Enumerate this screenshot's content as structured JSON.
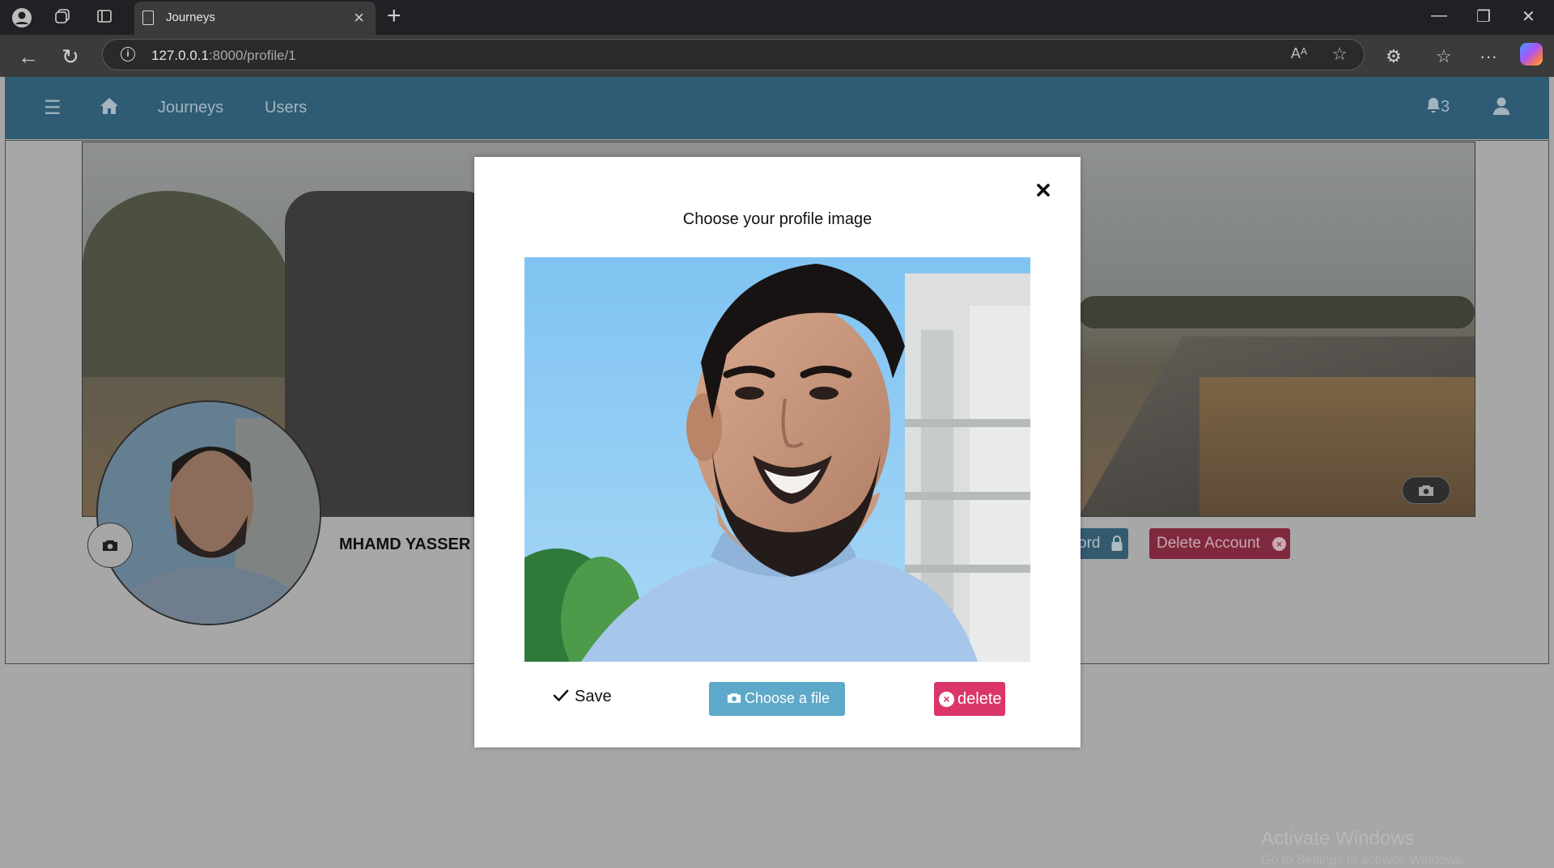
{
  "browser": {
    "tab_title": "Journeys",
    "url_host": "127.0.0.1",
    "url_rest": ":8000/profile/1"
  },
  "nav": {
    "links": [
      "Journeys",
      "Users"
    ],
    "notification_count": "3"
  },
  "profile": {
    "name": "MHAMD YASSER",
    "change_password_partial": "ord",
    "delete_account_label": "Delete Account"
  },
  "modal": {
    "title": "Choose your profile image",
    "save_label": "Save",
    "choose_label": "Choose a file",
    "delete_label": "delete"
  },
  "watermark": {
    "line1": "Activate Windows",
    "line2": "Go to Settings to activate Windows."
  },
  "colors": {
    "navbar": "#2f5c74",
    "choose_button": "#5ea9c9",
    "delete_button": "#dc3569",
    "delete_account": "#80283e"
  }
}
